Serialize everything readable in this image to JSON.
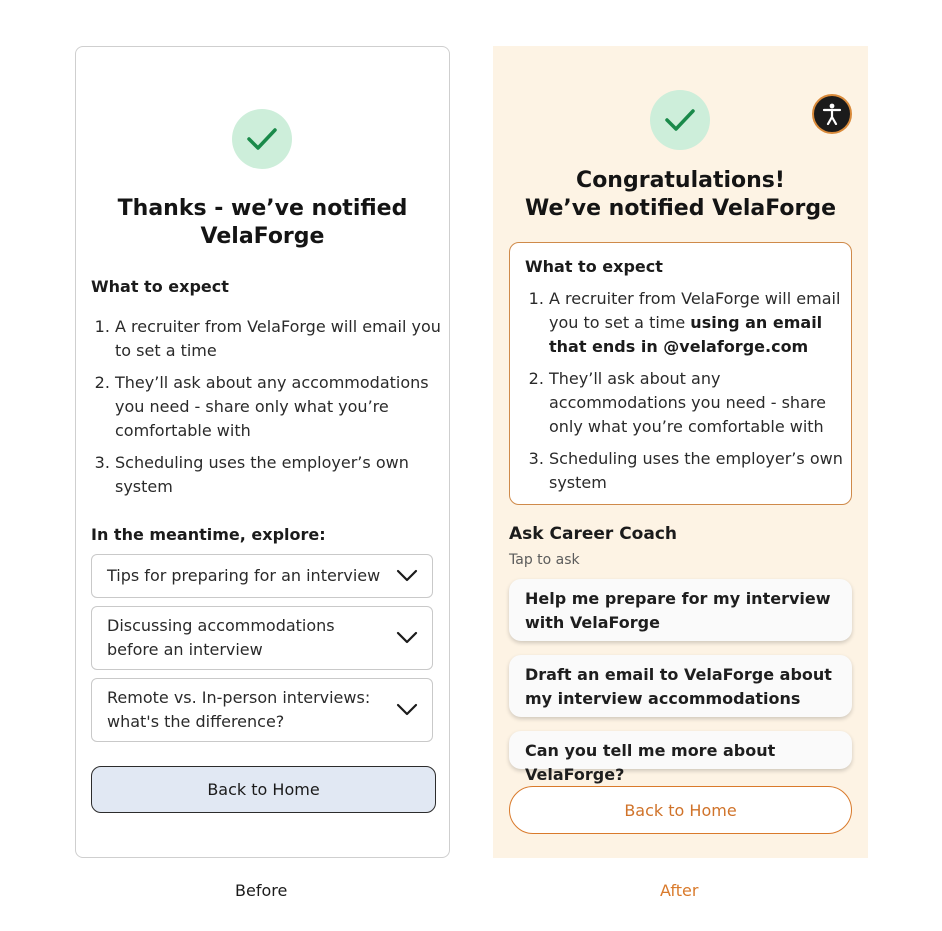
{
  "before": {
    "caption": "Before",
    "title_line1": "Thanks - we’ve notified",
    "title_line2": "VelaForge",
    "expect_heading": "What to expect",
    "steps": [
      "A recruiter from VelaForge will email you to set a time",
      "They’ll ask about any accommodations you need - share only what you’re comfortable with",
      "Scheduling uses the employer’s own system"
    ],
    "explore_heading": "In the meantime, explore:",
    "accordions": [
      "Tips for preparing for an interview",
      "Discussing accommodations before an interview",
      "Remote vs. In-person interviews: what's the difference?"
    ],
    "back_button": "Back to Home",
    "icons": {
      "success": "check-icon",
      "expand": "chevron-down-icon"
    }
  },
  "after": {
    "caption": "After",
    "title_line1": "Congratulations!",
    "title_line2": "We’ve notified VelaForge",
    "expect_heading": "What to expect",
    "step1_plain": "A recruiter from VelaForge will email you to set a time ",
    "step1_bold": "using an email that ends in @velaforge.com",
    "step2": "They’ll ask about any accommodations you need - share only what you’re comfortable with",
    "step3": "Scheduling uses the employer’s own system",
    "coach_heading": "Ask Career Coach",
    "coach_sub": "Tap to ask",
    "chips": [
      "Help me prepare for my interview with VelaForge",
      "Draft an email to VelaForge about my interview accommodations",
      "Can you tell me more about VelaForge?"
    ],
    "back_button": "Back to Home",
    "icons": {
      "success": "check-icon",
      "accessibility": "accessibility-icon"
    }
  },
  "colors": {
    "check_bg": "#cdeeda",
    "check_mark": "#1a8a4a",
    "after_bg": "#fdf3e4",
    "accent_orange": "#d97a2b",
    "before_button_bg": "#e1e8f3"
  }
}
